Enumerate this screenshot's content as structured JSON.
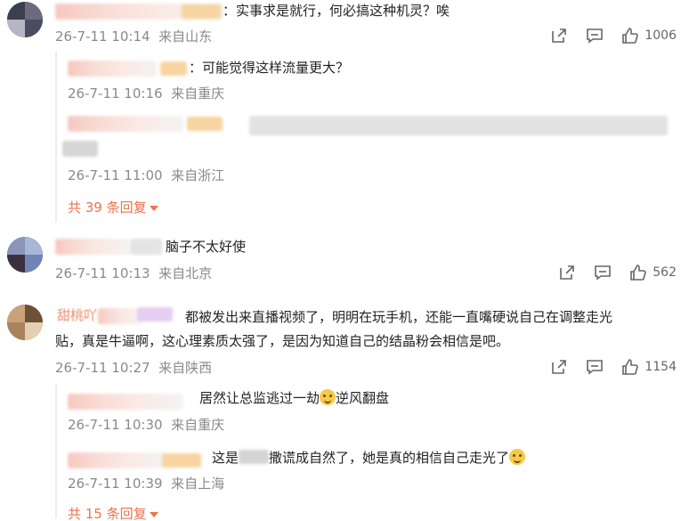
{
  "comments": [
    {
      "text": "：实事求是就行，何必搞这种机灵？唉",
      "time": "26-7-11 10:14",
      "location": "来自山东",
      "likes": "1006",
      "replies": [
        {
          "text": "：可能觉得这样流量更大？",
          "time": "26-7-11 10:16",
          "location": "来自重庆"
        },
        {
          "text": "",
          "time": "26-7-11 11:00",
          "location": "来自浙江"
        }
      ],
      "more": "共 39 条回复"
    },
    {
      "text": "脑子不太好使",
      "time": "26-7-11 10:13",
      "location": "来自北京",
      "likes": "562"
    },
    {
      "name_partial": "甜桃吖",
      "text_line1": "都被发出来直播视频了，明明在玩手机，还能一直嘴硬说自己在调整走光",
      "text_line2": "贴，真是牛逼啊，这心理素质太强了，是因为知道自己的结晶粉会相信是吧。",
      "time": "26-7-11 10:27",
      "location": "来自陕西",
      "likes": "1154",
      "replies": [
        {
          "text_a": "居然让总监逃过一劫",
          "text_b": "逆风翻盘",
          "time": "26-7-11 10:30",
          "location": "来自重庆"
        },
        {
          "text_a": "这是",
          "text_b": "撒谎成自然了，她是真的相信自己走光了",
          "time": "26-7-11 10:39",
          "location": "来自上海"
        }
      ],
      "more": "共 15 条回复"
    }
  ],
  "icons": {
    "share": "share-icon",
    "comment": "comment-icon",
    "like": "like-icon",
    "emoji": "grin-emoji-icon"
  },
  "colors": {
    "accent": "#eb7350",
    "meta": "#8a8a8a"
  }
}
